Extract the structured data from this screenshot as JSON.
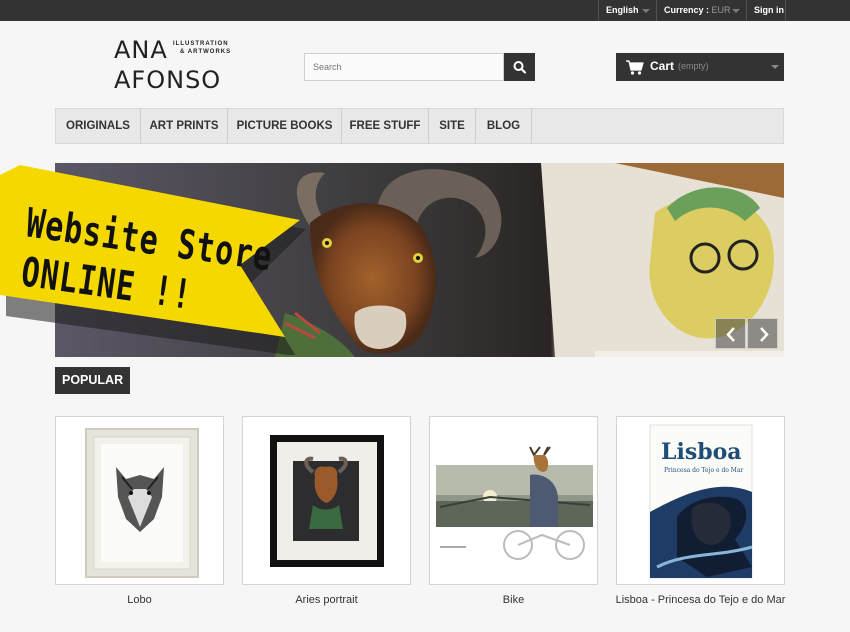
{
  "topbar": {
    "language": "English",
    "currency_label": "Currency :",
    "currency_value": "EUR",
    "signin": "Sign in"
  },
  "logo": {
    "line1": "ANA",
    "line2": "AFONSO",
    "tagline1": "ILLUSTRATION",
    "tagline2": "& ARTWORKS"
  },
  "search": {
    "placeholder": "Search"
  },
  "cart": {
    "label": "Cart",
    "status": "(empty)"
  },
  "nav": [
    "ORIGINALS",
    "ART PRINTS",
    "PICTURE BOOKS",
    "FREE STUFF",
    "SITE",
    "BLOG"
  ],
  "hero": {
    "banner_line1": "Website Store",
    "banner_line2": "ONLINE !!"
  },
  "section": {
    "title": "POPULAR"
  },
  "products": [
    {
      "name": "Lobo"
    },
    {
      "name": "Aries portrait"
    },
    {
      "name": "Bike"
    },
    {
      "name": "Lisboa - Princesa do Tejo e do Mar",
      "cover_title": "Lisboa",
      "cover_subtitle": "Princesa do Tejo e do Mar"
    }
  ],
  "colors": {
    "dark": "#333333",
    "banner_yellow": "#f5d800",
    "page_bg": "#f6f6f6"
  },
  "icons": [
    "caret-down-icon",
    "search-icon",
    "cart-icon",
    "chevron-left-icon",
    "chevron-right-icon"
  ]
}
